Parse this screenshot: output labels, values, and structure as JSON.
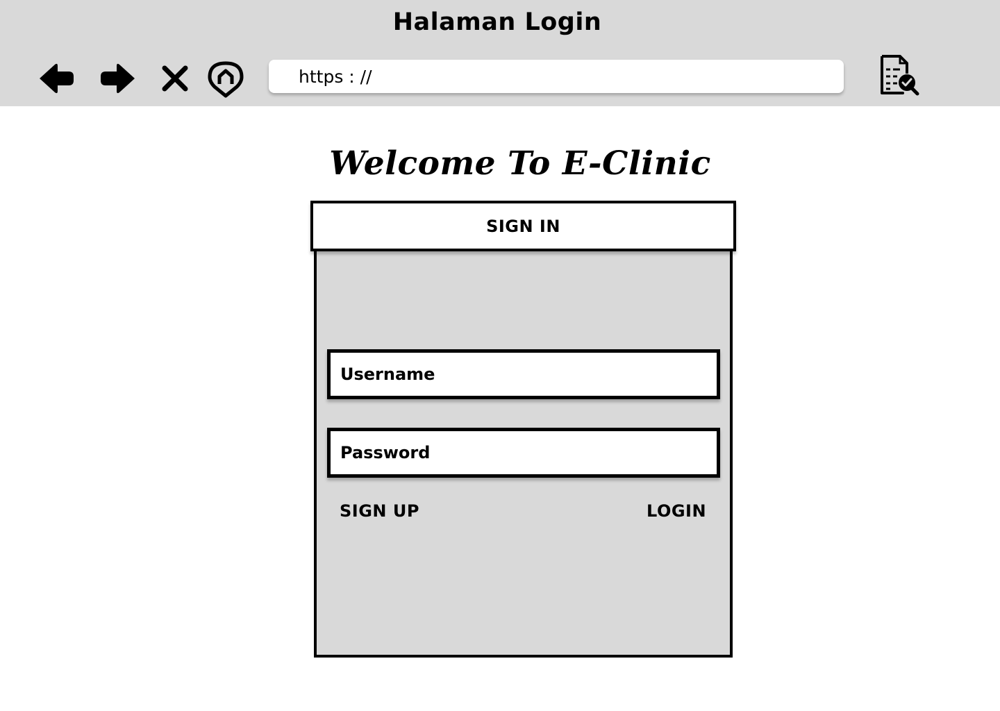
{
  "window": {
    "title": "Halaman Login"
  },
  "toolbar": {
    "back_icon": "arrow-left-icon",
    "forward_icon": "arrow-right-icon",
    "close_icon": "close-icon",
    "home_icon": "home-icon",
    "document_icon": "document-search-icon"
  },
  "url": {
    "value": "https : //"
  },
  "page": {
    "welcome": "Welcome To E-Clinic"
  },
  "form": {
    "header": "SIGN IN",
    "username_placeholder": "Username",
    "password_placeholder": "Password",
    "signup_label": "SIGN UP",
    "login_label": "LOGIN"
  },
  "colors": {
    "chrome": "#d9d9d9",
    "panel": "#d9d9d9",
    "border": "#000000",
    "field": "#ffffff"
  }
}
